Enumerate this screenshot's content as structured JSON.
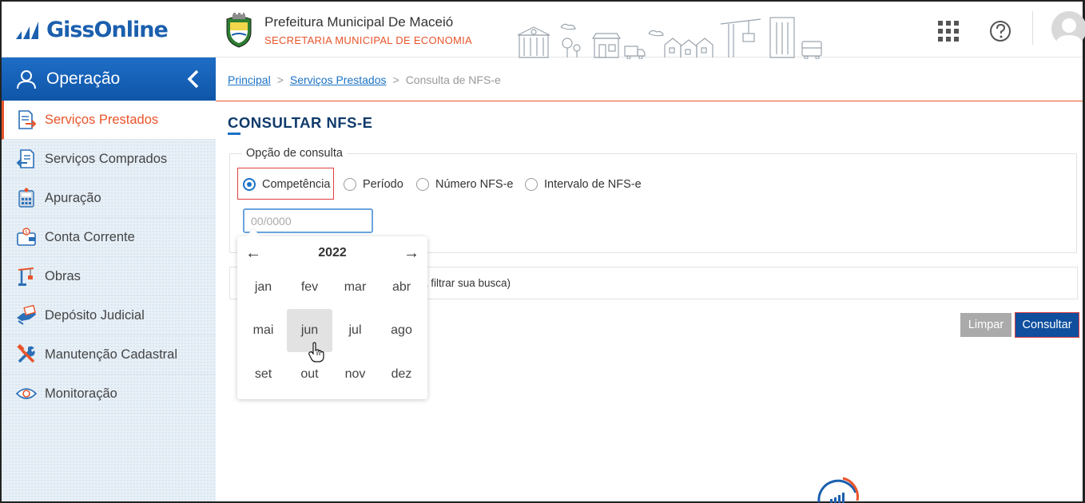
{
  "brand": {
    "logo_text": "GissOnline"
  },
  "municipality": {
    "name": "Prefeitura Municipal De Maceió",
    "secretariat": "SECRETARIA MUNICIPAL DE ECONOMIA"
  },
  "header_icons": [
    "apps-grid-icon",
    "help-icon",
    "avatar"
  ],
  "sidebar": {
    "title": "Operação",
    "items": [
      {
        "label": "Serviços Prestados",
        "icon": "document-out-icon",
        "active": true
      },
      {
        "label": "Serviços Comprados",
        "icon": "document-in-icon",
        "active": false
      },
      {
        "label": "Apuração",
        "icon": "calculator-icon",
        "active": false
      },
      {
        "label": "Conta Corrente",
        "icon": "wallet-icon",
        "active": false
      },
      {
        "label": "Obras",
        "icon": "crane-icon",
        "active": false
      },
      {
        "label": "Depósito Judicial",
        "icon": "deposit-icon",
        "active": false
      },
      {
        "label": "Manutenção Cadastral",
        "icon": "tools-icon",
        "active": false
      },
      {
        "label": "Monitoração",
        "icon": "eye-icon",
        "active": false
      }
    ]
  },
  "breadcrumb": {
    "items": [
      "Principal",
      "Serviços Prestados",
      "Consulta de NFS-e"
    ],
    "separator": ">"
  },
  "page": {
    "title": "CONSULTAR NFS-E",
    "option_legend": "Opção de consulta",
    "radio_options": [
      {
        "label": "Competência",
        "checked": true
      },
      {
        "label": "Período",
        "checked": false
      },
      {
        "label": "Número NFS-e",
        "checked": false
      },
      {
        "label": "Intervalo de NFS-e",
        "checked": false
      }
    ],
    "competencia_input": {
      "value": "",
      "placeholder": "00/0000"
    },
    "filter_text": "a filtrar sua busca)",
    "buttons": {
      "clear": "Limpar",
      "submit": "Consultar"
    }
  },
  "datepicker": {
    "prev": "←",
    "next": "→",
    "year": "2022",
    "months": [
      "jan",
      "fev",
      "mar",
      "abr",
      "mai",
      "jun",
      "jul",
      "ago",
      "set",
      "out",
      "nov",
      "dez"
    ],
    "hovered_month": "jun"
  },
  "colors": {
    "brand_blue": "#1b5fae",
    "accent_orange": "#e8542a",
    "primary_button": "#0f4f9e",
    "secondary_button": "#aaaaaa",
    "highlight_red": "#e04040"
  }
}
